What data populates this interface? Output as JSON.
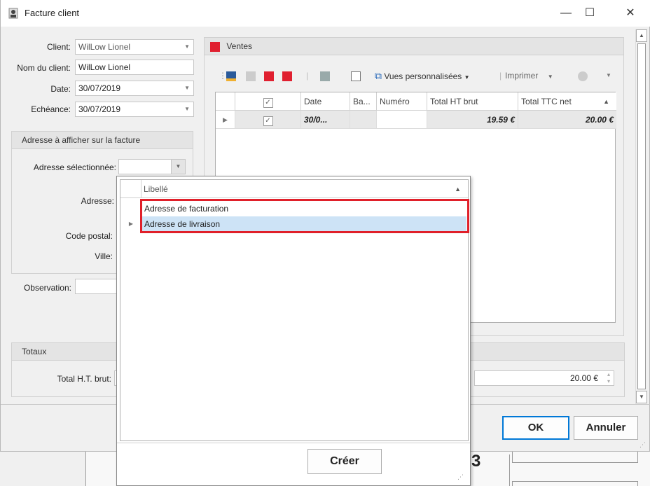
{
  "window": {
    "title": "Facture client",
    "controls": {
      "minimize": "—",
      "maximize": "☐",
      "close": "✕"
    }
  },
  "form": {
    "client_label": "Client:",
    "client_value": "WilLow Lionel",
    "nom_label": "Nom du client:",
    "nom_value": "WilLow Lionel",
    "date_label": "Date:",
    "date_value": "30/07/2019",
    "echeance_label": "Echéance:",
    "echeance_value": "30/07/2019"
  },
  "address_group": {
    "title": "Adresse à afficher sur la facture",
    "selected_label": "Adresse sélectionnée:",
    "adresse_label": "Adresse:",
    "code_postal_label": "Code postal:",
    "ville_label": "Ville:"
  },
  "observation_label": "Observation:",
  "totaux": {
    "title": "Totaux",
    "total_ht_label": "Total H.T. brut:",
    "total_right_value": "20.00 €"
  },
  "ventes": {
    "title": "Ventes",
    "toolbar": {
      "vues_label": "Vues personnalisées",
      "imprimer_label": "Imprimer"
    },
    "columns": [
      "",
      "Date",
      "Ba...",
      "Numéro",
      "Total HT brut",
      "Total TTC net"
    ],
    "row": {
      "date": "30/0...",
      "ba": "",
      "numero": "",
      "total_ht": "19.59 €",
      "total_ttc": "20.00 €"
    }
  },
  "popup": {
    "column_header": "Libellé",
    "items": [
      "Adresse de facturation",
      "Adresse de livraison"
    ],
    "create_button": "Créer"
  },
  "buttons": {
    "ok": "OK",
    "annuler": "Annuler"
  },
  "background_text": "3",
  "colors": {
    "highlight_border": "#e0202a",
    "selected_row": "#cde3f6",
    "brand_red": "#e02030"
  }
}
